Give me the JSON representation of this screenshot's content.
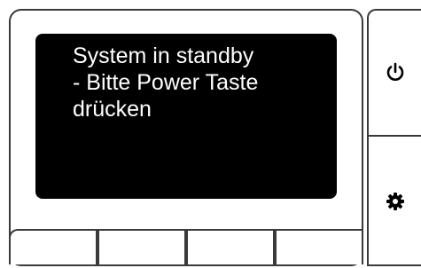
{
  "display": {
    "message": "System in standby\n- Bitte Power Taste\ndrücken"
  },
  "side_buttons": [
    {
      "icon": "power-icon"
    },
    {
      "icon": "gear-icon"
    }
  ],
  "soft_keys": [
    {
      "label": ""
    },
    {
      "label": ""
    },
    {
      "label": ""
    },
    {
      "label": ""
    }
  ],
  "colors": {
    "screen_bg": "#000000",
    "screen_text": "#ffffff",
    "outline": "#3a3a3a"
  }
}
